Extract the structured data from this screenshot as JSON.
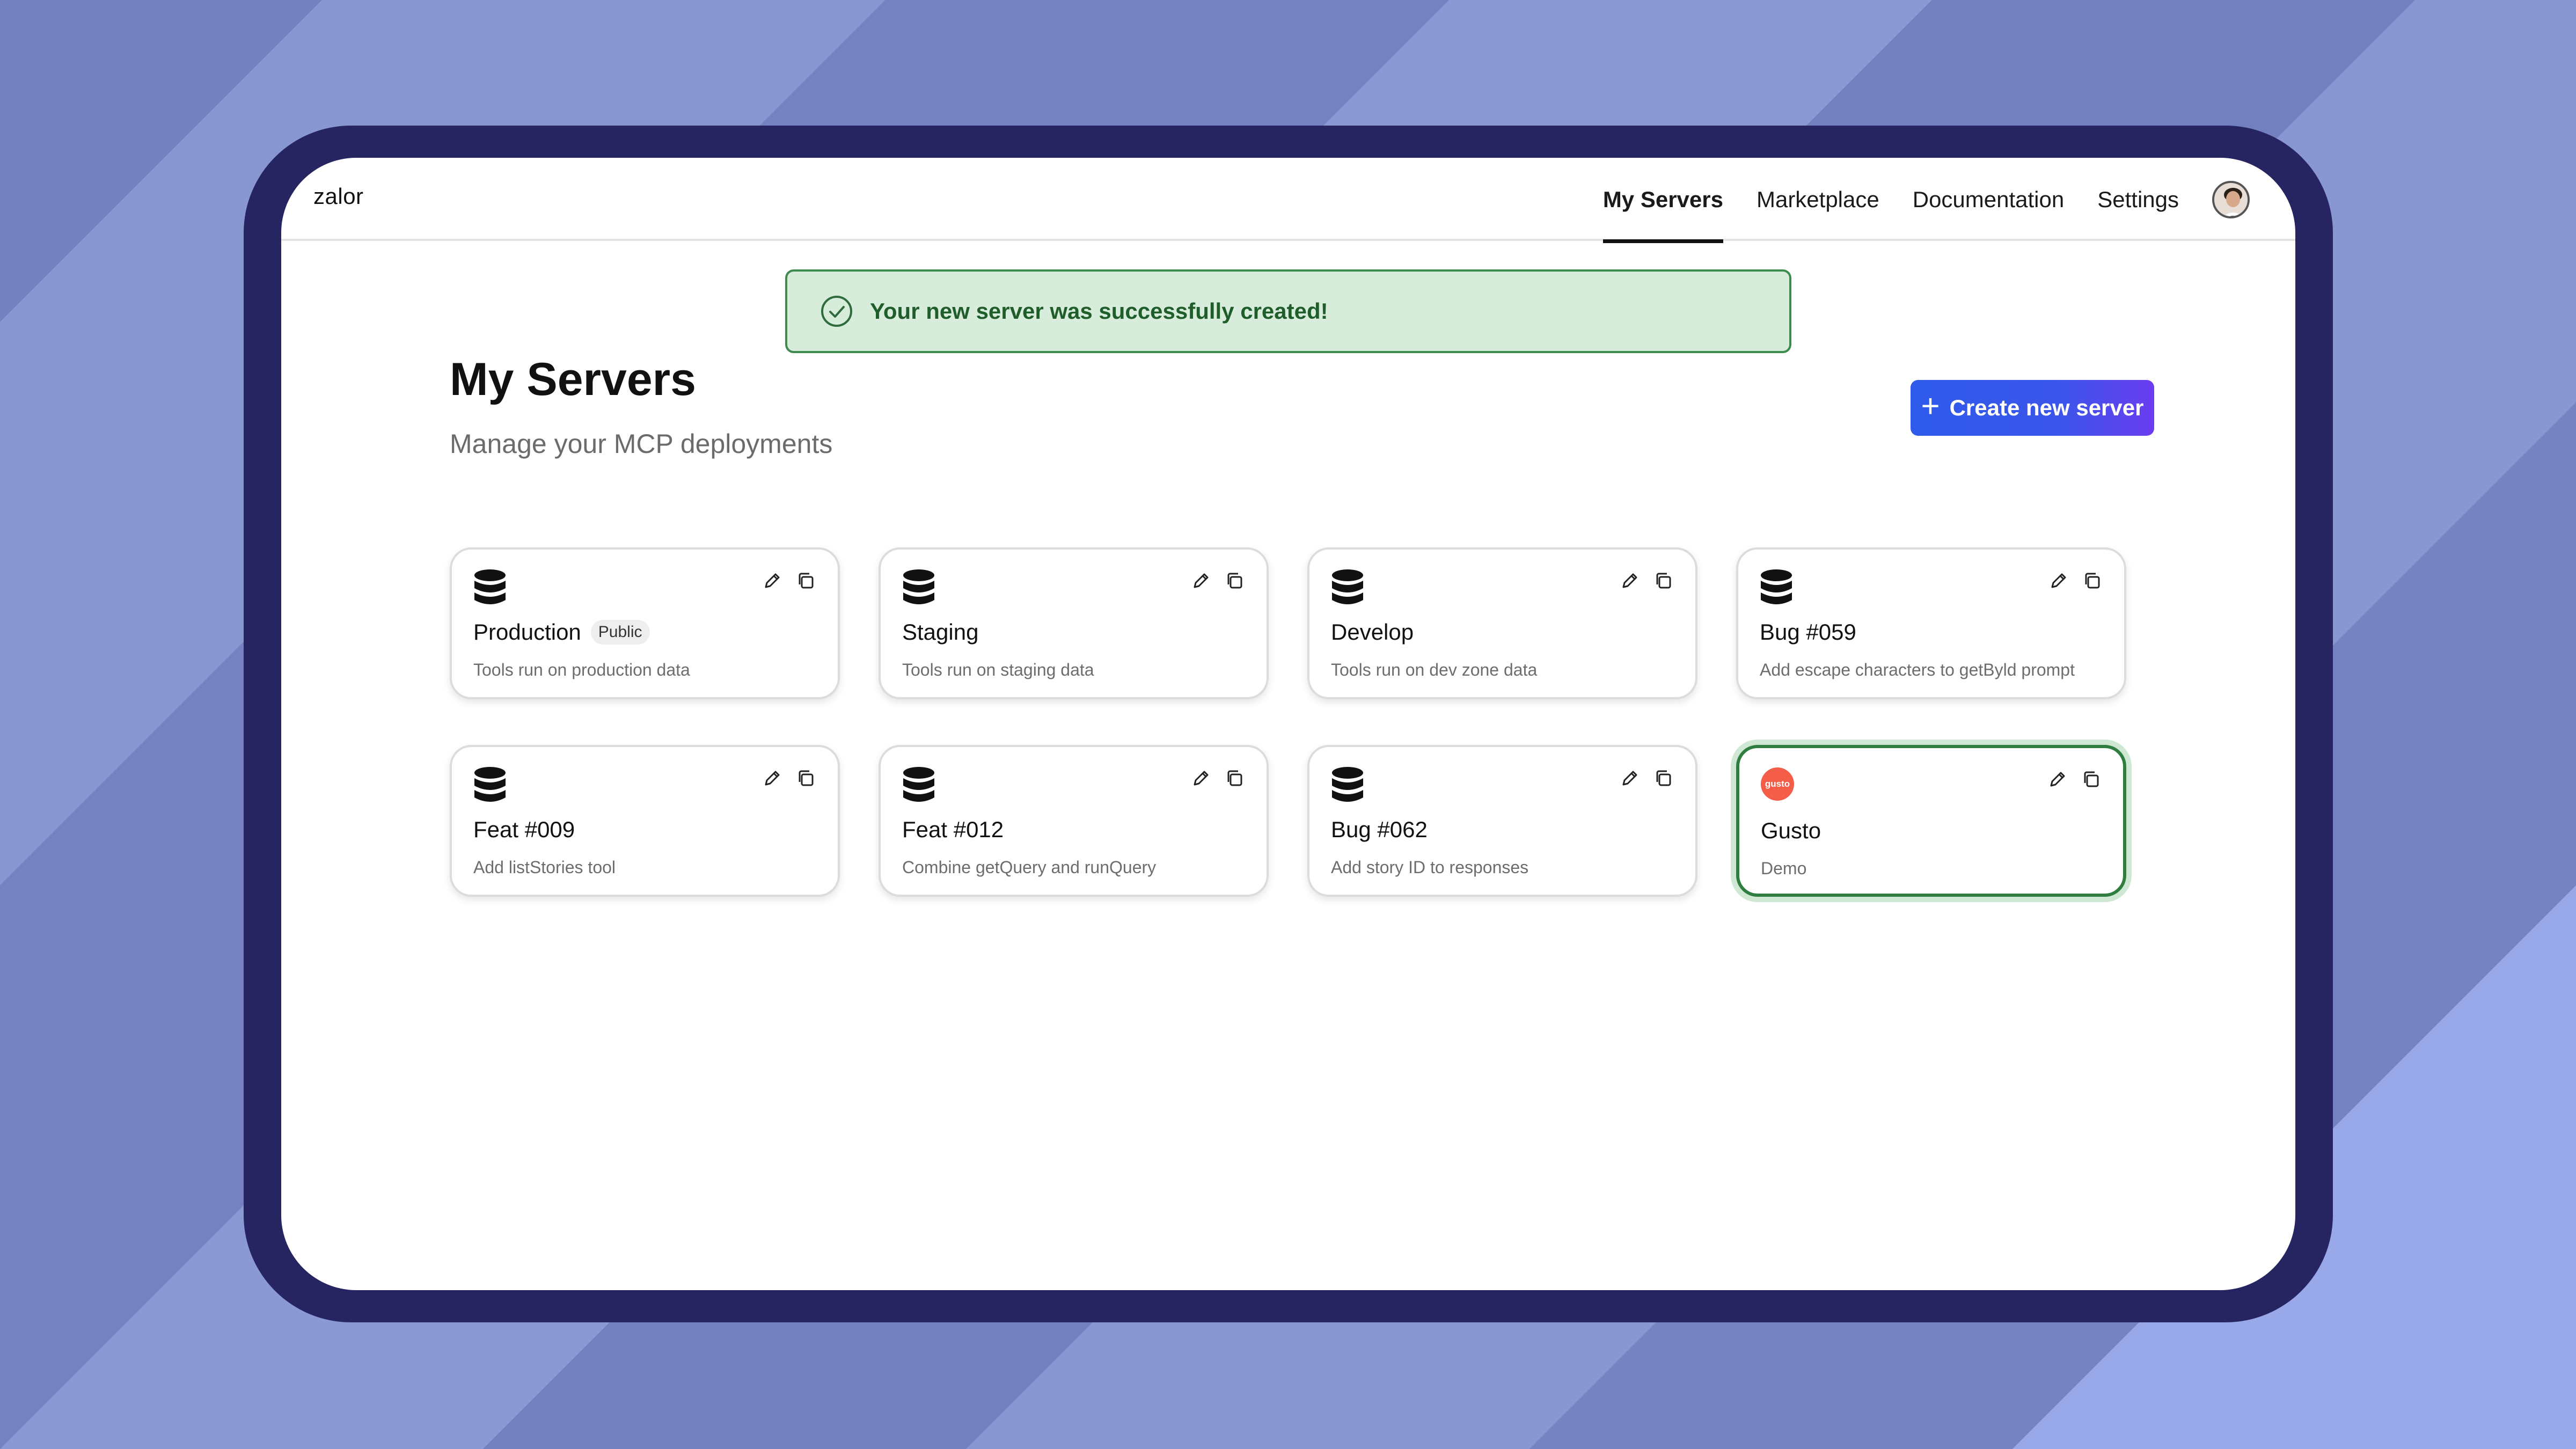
{
  "brand": "zalor",
  "nav": {
    "items": [
      {
        "label": "My Servers",
        "active": true
      },
      {
        "label": "Marketplace",
        "active": false
      },
      {
        "label": "Documentation",
        "active": false
      },
      {
        "label": "Settings",
        "active": false
      }
    ]
  },
  "alert": {
    "message": "Your new server was successfully created!",
    "icon": "check-circle-icon",
    "color": "#3f8a4d"
  },
  "page": {
    "title": "My Servers",
    "subtitle": "Manage your MCP deployments",
    "create_button": "Create new server"
  },
  "servers": [
    {
      "title": "Production",
      "badge": "Public",
      "description": "Tools run on production data",
      "icon": "database-icon"
    },
    {
      "title": "Staging",
      "badge": "",
      "description": "Tools run on staging data",
      "icon": "database-icon"
    },
    {
      "title": "Develop",
      "badge": "",
      "description": "Tools run on dev zone data",
      "icon": "database-icon"
    },
    {
      "title": "Bug #059",
      "badge": "",
      "description": "Add escape characters to getByld prompt",
      "icon": "database-icon"
    },
    {
      "title": "Feat #009",
      "badge": "",
      "description": "Add listStories tool",
      "icon": "database-icon"
    },
    {
      "title": "Feat #012",
      "badge": "",
      "description": "Combine getQuery and runQuery",
      "icon": "database-icon"
    },
    {
      "title": "Bug #062",
      "badge": "",
      "description": "Add story ID to responses",
      "icon": "database-icon"
    },
    {
      "title": "Gusto",
      "badge": "",
      "description": "Demo",
      "icon": "gusto-logo",
      "logo_text": "gusto",
      "selected": true
    }
  ],
  "colors": {
    "accent": "#2f5bea",
    "accent_end": "#6a3df0",
    "success_bg": "#d7ecdb",
    "device_frame": "#272462"
  }
}
